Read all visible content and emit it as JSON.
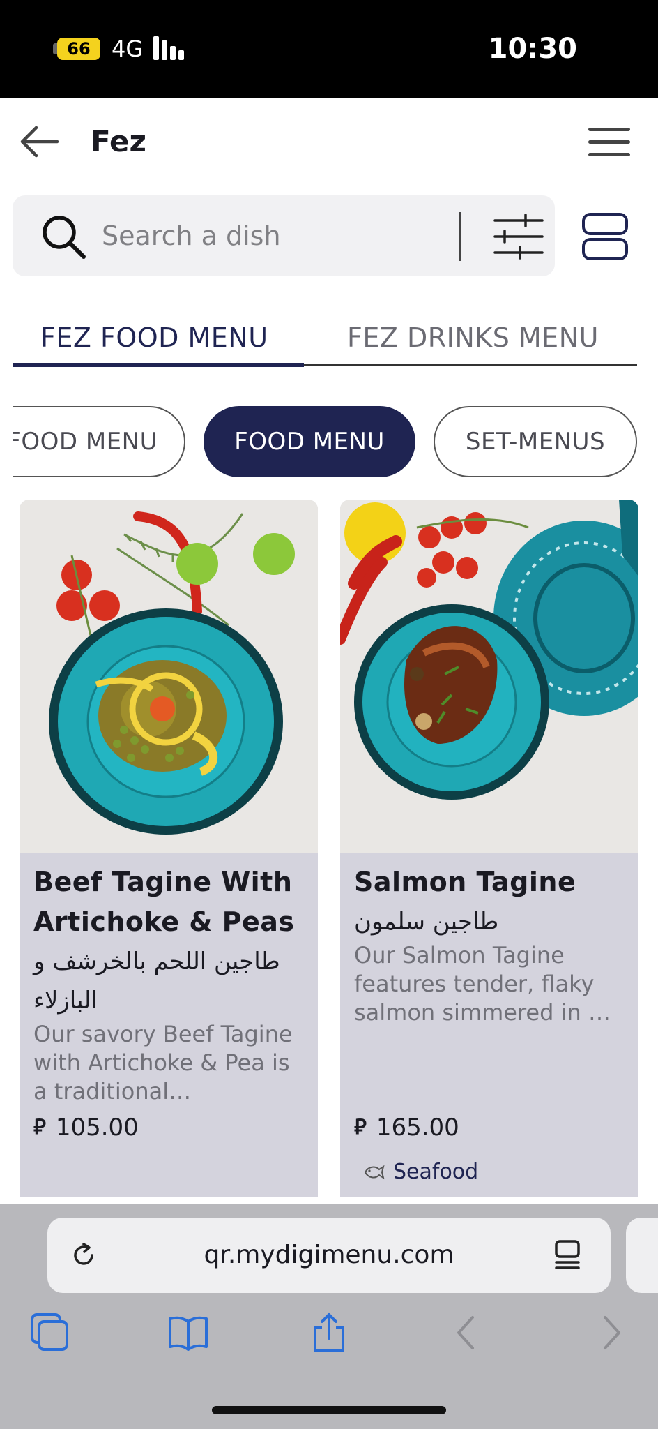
{
  "status_bar": {
    "battery": "66",
    "network": "4G",
    "time": "10:30"
  },
  "header": {
    "title": "Fez"
  },
  "search": {
    "placeholder": "Search a dish"
  },
  "tabs": [
    {
      "label": "FEZ FOOD MENU",
      "active": true
    },
    {
      "label": "FEZ DRINKS MENU",
      "active": false
    }
  ],
  "categories": [
    {
      "label": "FOOD MENU",
      "active": false
    },
    {
      "label": "FOOD MENU",
      "active": true
    },
    {
      "label": "SET-MENUS",
      "active": false
    }
  ],
  "dishes": [
    {
      "title": "Beef Tagine With Artichoke & Peas",
      "arabic": "طاجين اللحم بالخرشف و البازلاء",
      "description": "Our savory Beef Tagine with Artichoke & Pea is a traditional…",
      "currency_symbol": "⃁",
      "price": "105.00"
    },
    {
      "title": "Salmon Tagine",
      "arabic": "طاجين سلمون",
      "description": "Our Salmon Tagine features tender, flaky salmon simmered in …",
      "currency_symbol": "⃁",
      "price": "165.00",
      "tag": "Seafood"
    }
  ],
  "browser": {
    "url": "qr.mydigimenu.com"
  },
  "colors": {
    "brand_navy": "#1f2452",
    "card_bg": "#d4d3dd",
    "plate_teal": "#1fa8b4"
  }
}
